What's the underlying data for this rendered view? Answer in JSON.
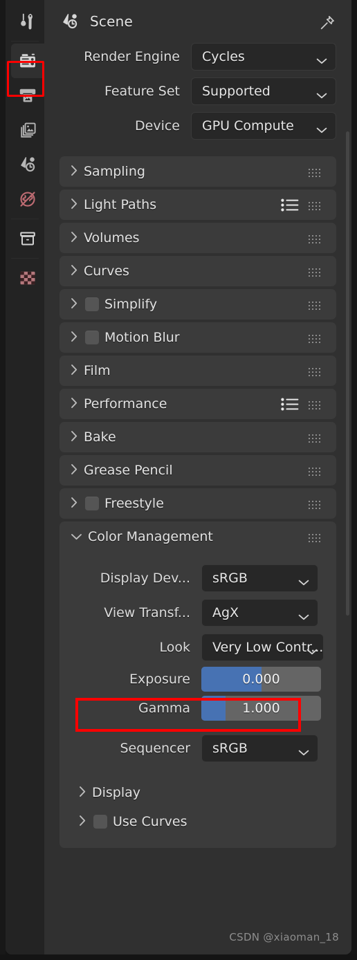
{
  "app": "Blender Properties Editor",
  "theme": {
    "bg": "#303030",
    "panel_header": "#3b3b3b",
    "widget": "#272727",
    "slider_track": "#656565",
    "slider_fill": "#4772b3",
    "text": "#e2e2e2",
    "highlight": "#fe0000",
    "tabstrip": "#232323"
  },
  "tabstrip": {
    "items": [
      {
        "id": "tool",
        "icon": "tool-icon",
        "label": "Tool",
        "active": false,
        "color": "#c8c8c8"
      },
      {
        "id": "render",
        "icon": "render-camera-icon",
        "label": "Render",
        "active": true,
        "highlighted": true,
        "color": "#d6d6d6"
      },
      {
        "id": "output",
        "icon": "output-printer-icon",
        "label": "Output",
        "active": false,
        "color": "#b6b6b6"
      },
      {
        "id": "view-layer",
        "icon": "view-layer-images-icon",
        "label": "View Layer",
        "active": false,
        "color": "#b6b6b6"
      },
      {
        "id": "scene",
        "icon": "scene-cone-icon",
        "label": "Scene",
        "active": false,
        "color": "#b6b6b6"
      },
      {
        "id": "world",
        "icon": "world-globe-icon",
        "label": "World",
        "active": false,
        "color": "#bd6b72"
      },
      {
        "id": "collection",
        "icon": "collection-box-icon",
        "label": "Collection",
        "active": false,
        "color": "#d3d3d3"
      },
      {
        "id": "texture",
        "icon": "texture-checker-icon",
        "label": "Texture",
        "active": false,
        "color": "#bd6b72"
      }
    ]
  },
  "header": {
    "icon": "scene-cone-icon",
    "title": "Scene",
    "pin_icon": "pin-icon"
  },
  "render_settings": {
    "rows": [
      {
        "label": "Render Engine",
        "value": "Cycles",
        "type": "dropdown"
      },
      {
        "label": "Feature Set",
        "value": "Supported",
        "type": "dropdown"
      },
      {
        "label": "Device",
        "value": "GPU Compute",
        "type": "dropdown"
      }
    ]
  },
  "panels": [
    {
      "title": "Sampling",
      "open": false,
      "checkbox": null,
      "preset": false
    },
    {
      "title": "Light Paths",
      "open": false,
      "checkbox": null,
      "preset": true
    },
    {
      "title": "Volumes",
      "open": false,
      "checkbox": null,
      "preset": false
    },
    {
      "title": "Curves",
      "open": false,
      "checkbox": null,
      "preset": false
    },
    {
      "title": "Simplify",
      "open": false,
      "checkbox": false,
      "preset": false
    },
    {
      "title": "Motion Blur",
      "open": false,
      "checkbox": false,
      "preset": false
    },
    {
      "title": "Film",
      "open": false,
      "checkbox": null,
      "preset": false
    },
    {
      "title": "Performance",
      "open": false,
      "checkbox": null,
      "preset": true
    },
    {
      "title": "Bake",
      "open": false,
      "checkbox": null,
      "preset": false
    },
    {
      "title": "Grease Pencil",
      "open": false,
      "checkbox": null,
      "preset": false
    },
    {
      "title": "Freestyle",
      "open": false,
      "checkbox": false,
      "preset": false
    }
  ],
  "color_management": {
    "title": "Color Management",
    "open": true,
    "rows": [
      {
        "label": "Display Dev...",
        "value": "sRGB",
        "type": "dropdown",
        "highlighted": false
      },
      {
        "label": "View Transf...",
        "value": "AgX",
        "type": "dropdown",
        "highlighted": false
      },
      {
        "label": "Look",
        "value": "Very Low Contr...",
        "type": "dropdown",
        "highlighted": true
      },
      {
        "label": "Exposure",
        "value": "0.000",
        "type": "slider",
        "fill_pct": 50
      },
      {
        "label": "Gamma",
        "value": "1.000",
        "type": "slider",
        "fill_pct": 20
      },
      {
        "label": "Sequencer",
        "value": "sRGB",
        "type": "dropdown",
        "highlighted": false
      }
    ],
    "subpanels": [
      {
        "title": "Display",
        "checkbox": null
      },
      {
        "title": "Use Curves",
        "checkbox": false
      }
    ]
  },
  "watermark": "CSDN @xiaoman_18"
}
